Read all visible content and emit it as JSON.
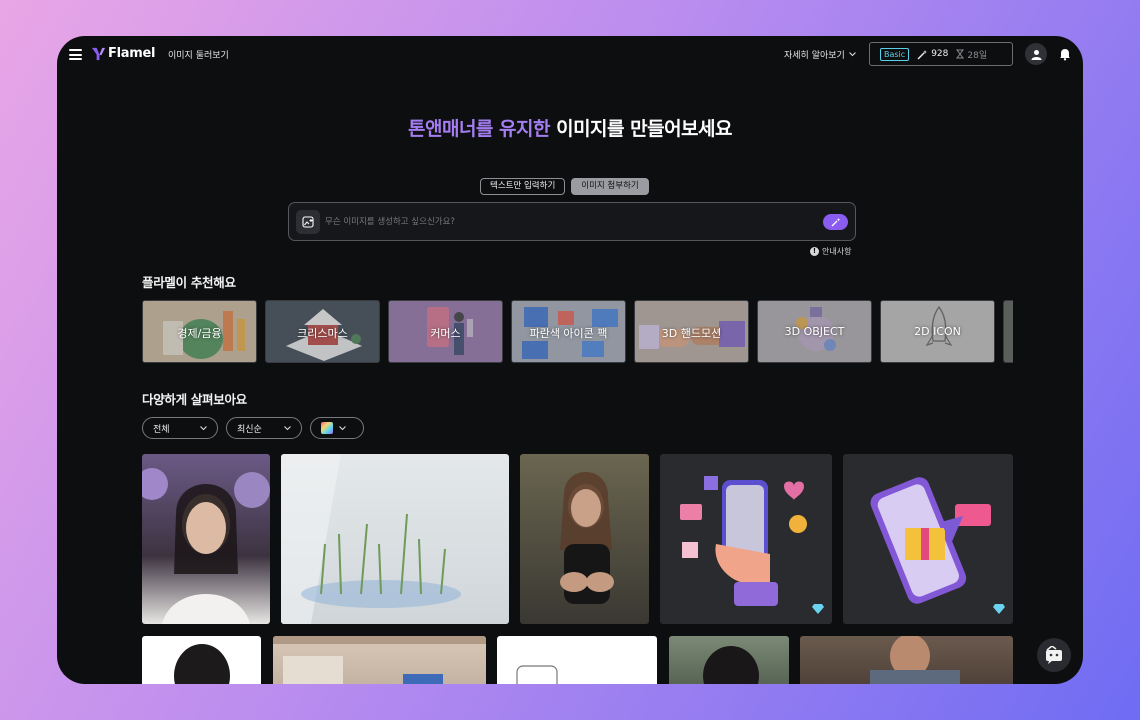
{
  "header": {
    "logo_text": "Flamel",
    "nav_browse": "이미지 둘러보기",
    "learn_more": "자세히 알아보기",
    "plan": "Basic",
    "credits": "928",
    "days": "28일"
  },
  "hero": {
    "title_accent": "톤앤매너를 유지한",
    "title_rest": " 이미지를 만들어보세요",
    "tabs": [
      "텍스트만 입력하기",
      "이미지 첨부하기"
    ],
    "active_tab": 1,
    "prompt_placeholder": "무슨 이미지를 생성하고 싶으신가요?",
    "notice": "안내사항"
  },
  "recommend": {
    "title": "플라멜이 추천해요",
    "items": [
      {
        "label": "경제/금융",
        "bg": "#c9b79a"
      },
      {
        "label": "크리스마스",
        "bg": "#2b3a46"
      },
      {
        "label": "커머스",
        "bg": "#8d6aa8"
      },
      {
        "label": "파란색 아이콘 팩",
        "bg": "#9fa7b6"
      },
      {
        "label": "3D 핸드모션",
        "bg": "#b5a79f"
      },
      {
        "label": "3D OBJECT",
        "bg": "#a9a6ad"
      },
      {
        "label": "2D ICON",
        "bg": "#bdbdbd"
      }
    ]
  },
  "explore": {
    "title": "다양하게 살펴보아요",
    "filters": [
      "전체",
      "최신순"
    ]
  },
  "colors": {
    "accent": "#a47ef0",
    "button": "#8a5cf0",
    "badge": "#5ad1e9"
  }
}
